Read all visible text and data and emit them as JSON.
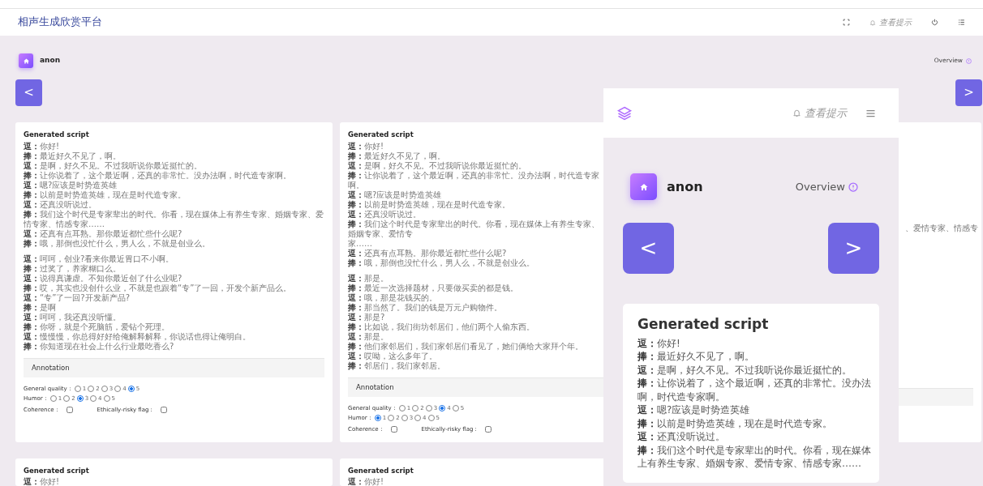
{
  "navbar": {
    "title": "相声生成欣赏平台",
    "hint": "查看提示"
  },
  "user": {
    "name": "anon",
    "overview": "Overview"
  },
  "nav_buttons": {
    "prev": "<",
    "next": ">"
  },
  "cards": [
    {
      "kind": "full",
      "title": "Generated script",
      "blocks": [
        [
          {
            "speaker": "逗：",
            "text": "你好!"
          },
          {
            "speaker": "捧：",
            "text": "最近好久不见了，啊。"
          },
          {
            "speaker": "逗：",
            "text": "是啊，好久不见。不过我听说你最近挺忙的。"
          },
          {
            "speaker": "捧：",
            "text": "让你说着了，这个最近啊，还真的非常忙。没办法啊，时代造专家啊。"
          },
          {
            "speaker": "逗：",
            "text": "嗯?应该是时势造英雄"
          },
          {
            "speaker": "捧：",
            "text": "以前是时势造英雄，现在是时代造专家。"
          },
          {
            "speaker": "逗：",
            "text": "还真没听说过。"
          },
          {
            "speaker": "捧：",
            "text": "我们这个时代是专家辈出的时代。你看，现在媒体上有养生专家、婚姻专家、爱情专家、情感专家……"
          },
          {
            "speaker": "逗：",
            "text": "还真有点耳熟。那你最近都忙些什么呢?"
          },
          {
            "speaker": "捧：",
            "text": "哦，那倒也没忙什么，男人么，不就是创业么。"
          }
        ],
        [
          {
            "speaker": "逗：",
            "text": "呵呵，创业?看来你最近胃口不小啊。"
          },
          {
            "speaker": "捧：",
            "text": "过奖了，养家糊口么。"
          },
          {
            "speaker": "逗：",
            "text": "说得真谦虚。不知你最近创了什么业呢?"
          },
          {
            "speaker": "捧：",
            "text": "哎，其实也没创什么业，不就是也跟着“专”了一回，开发个新产品么。"
          },
          {
            "speaker": "逗：",
            "text": "“专”了一回?开发新产品?"
          },
          {
            "speaker": "捧：",
            "text": "是啊"
          },
          {
            "speaker": "逗：",
            "text": "呵呵，我还真没听懂。"
          },
          {
            "speaker": "捧：",
            "text": "你呀，就是个死脑筋，爱钻个死理。"
          },
          {
            "speaker": "逗：",
            "text": "慢慢慢，你总得好好给俺解释解释，你说话也得让俺明白。"
          },
          {
            "speaker": "捧：",
            "text": "你知道现在社会上什么行业最吃香么?"
          }
        ]
      ],
      "annotation": {
        "title": "Annotation",
        "ratings": [
          {
            "label": "General quality：",
            "options": [
              {
                "label": "1",
                "selected": false
              },
              {
                "label": "2",
                "selected": false
              },
              {
                "label": "3",
                "selected": false
              },
              {
                "label": "4",
                "selected": false
              },
              {
                "label": "5",
                "selected": true
              }
            ]
          },
          {
            "label": "Humor：",
            "options": [
              {
                "label": "1",
                "selected": false
              },
              {
                "label": "2",
                "selected": false
              },
              {
                "label": "3",
                "selected": true
              },
              {
                "label": "4",
                "selected": false
              },
              {
                "label": "5",
                "selected": false
              }
            ]
          }
        ],
        "flags": [
          {
            "label": "Coherence：",
            "checked": false
          },
          {
            "label": "Ethically-risky flag：",
            "checked": false
          }
        ]
      }
    },
    {
      "kind": "full",
      "title": "Generated script",
      "blocks": [
        [
          {
            "speaker": "逗：",
            "text": "你好!"
          },
          {
            "speaker": "捧：",
            "text": "最近好久不见了，啊。"
          },
          {
            "speaker": "逗：",
            "text": "是啊，好久不见。不过我听说你最近挺忙的。"
          },
          {
            "speaker": "捧：",
            "text": "让你说着了，这个最近啊，还真的非常忙。没办法啊，时代造专家啊。"
          },
          {
            "speaker": "逗：",
            "text": "嗯?应该是时势造英雄"
          },
          {
            "speaker": "捧：",
            "text": "以前是时势造英雄，现在是时代造专家。"
          },
          {
            "speaker": "逗：",
            "text": "还真没听说过。"
          },
          {
            "speaker": "捧：",
            "text": "我们这个时代是专家辈出的时代。你看，现在媒体上有养生专家、婚姻专家、爱情专",
            "continuation": "家……"
          },
          {
            "speaker": "逗：",
            "text": "还真有点耳熟。那你最近都忙些什么呢?"
          },
          {
            "speaker": "捧：",
            "text": "哦，那倒也没忙什么，男人么，不就是创业么。"
          }
        ],
        [
          {
            "speaker": "逗：",
            "text": "那是。"
          },
          {
            "speaker": "捧：",
            "text": "最近一次选择题材，只要做买卖的都是钱。"
          },
          {
            "speaker": "逗：",
            "text": "哦，那是花钱买的。"
          },
          {
            "speaker": "捧：",
            "text": "那当然了。我们的钱是万元户购物件。"
          },
          {
            "speaker": "逗：",
            "text": "那是?"
          },
          {
            "speaker": "捧：",
            "text": "比如说，我们街坊邻居们，他们两个人偷东西。"
          },
          {
            "speaker": "逗：",
            "text": "那是。"
          },
          {
            "speaker": "捧：",
            "text": "他们家邻居们，我们家邻居们看见了，她们俩给大家拜个年。"
          },
          {
            "speaker": "逗：",
            "text": "哎呦，这么多年了。"
          },
          {
            "speaker": "捧：",
            "text": "邻居们，我们家邻居。"
          }
        ]
      ],
      "annotation": {
        "title": "Annotation",
        "ratings": [
          {
            "label": "General quality：",
            "options": [
              {
                "label": "1",
                "selected": false
              },
              {
                "label": "2",
                "selected": false
              },
              {
                "label": "3",
                "selected": false
              },
              {
                "label": "4",
                "selected": true
              },
              {
                "label": "5",
                "selected": false
              }
            ]
          },
          {
            "label": "Humor：",
            "options": [
              {
                "label": "1",
                "selected": true
              },
              {
                "label": "2",
                "selected": false
              },
              {
                "label": "3",
                "selected": false
              },
              {
                "label": "4",
                "selected": false
              },
              {
                "label": "5",
                "selected": false
              }
            ]
          }
        ],
        "flags": [
          {
            "label": "Coherence：",
            "checked": false
          },
          {
            "label": "Ethically-risky flag：",
            "checked": false
          }
        ]
      }
    },
    {
      "kind": "covered",
      "fragment": "、爱情专家、情感专"
    }
  ],
  "bottom_cards": [
    {
      "title": "Generated script",
      "lines": [
        {
          "speaker": "逗：",
          "text": "你好!"
        }
      ]
    },
    {
      "title": "Generated script",
      "lines": [
        {
          "speaker": "逗：",
          "text": "你好!"
        }
      ]
    }
  ],
  "mobile_view": {
    "hint": "查看提示",
    "user": {
      "name": "anon",
      "overview": "Overview"
    },
    "nav_buttons": {
      "prev": "<",
      "next": ">"
    },
    "card": {
      "title": "Generated script",
      "lines": [
        {
          "speaker": "逗：",
          "text": "你好!"
        },
        {
          "speaker": "捧：",
          "text": "最近好久不见了，啊。"
        },
        {
          "speaker": "逗：",
          "text": "是啊，好久不见。不过我听说你最近挺忙的。"
        },
        {
          "speaker": "捧：",
          "text": "让你说着了，这个最近啊，还真的非常忙。没办法啊，时代造专家啊。"
        },
        {
          "speaker": "逗：",
          "text": "嗯?应该是时势造英雄"
        },
        {
          "speaker": "捧：",
          "text": "以前是时势造英雄，现在是时代造专家。"
        },
        {
          "speaker": "逗：",
          "text": "还真没听说过。"
        },
        {
          "speaker": "捧：",
          "text": "我们这个时代是专家辈出的时代。你看，现在媒体上有养生专家、婚姻专家、爱情专家、情感专家……"
        }
      ]
    }
  }
}
